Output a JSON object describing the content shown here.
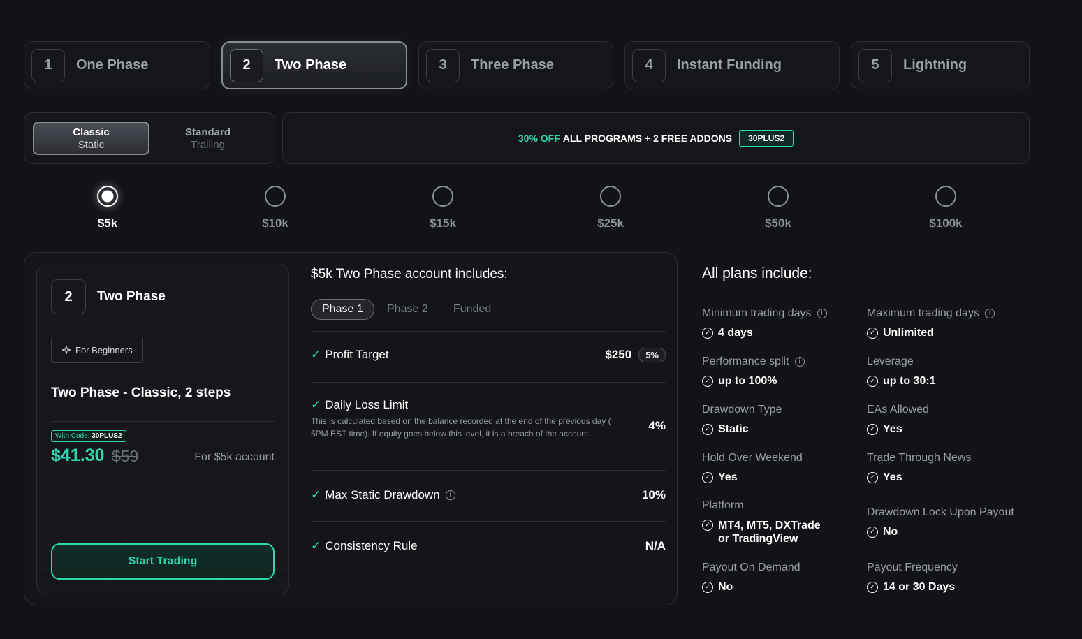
{
  "programs": [
    {
      "num": "1",
      "label": "One Phase"
    },
    {
      "num": "2",
      "label": "Two Phase"
    },
    {
      "num": "3",
      "label": "Three Phase"
    },
    {
      "num": "4",
      "label": "Instant Funding"
    },
    {
      "num": "5",
      "label": "Lightning"
    }
  ],
  "account_types": [
    {
      "title": "Classic",
      "sub": "Static"
    },
    {
      "title": "Standard",
      "sub": "Trailing"
    }
  ],
  "promo": {
    "off": "30% OFF",
    "text": "ALL PROGRAMS + 2 FREE ADDONS",
    "code": "30PLUS2"
  },
  "sizes": [
    "$5k",
    "$10k",
    "$15k",
    "$25k",
    "$50k",
    "$100k"
  ],
  "card": {
    "num": "2",
    "title": "Two Phase",
    "badge": "For Beginners",
    "subtitle": "Two Phase - Classic, 2 steps",
    "with_code_label": "With Code:",
    "with_code_value": "30PLUS2",
    "price": "$41.30",
    "old_price": "$59",
    "for_account": "For $5k account",
    "cta": "Start Trading"
  },
  "includes": {
    "title": "$5k Two Phase account includes:",
    "phases": [
      "Phase 1",
      "Phase 2",
      "Funded"
    ],
    "rules": [
      {
        "label": "Profit Target",
        "value": "$250",
        "pct": "5%"
      },
      {
        "label": "Daily Loss Limit",
        "value": "4%",
        "desc": "This is calculated based on the balance recorded at the end of the previous day ( 5PM EST time). If equity goes below this level, it is a breach of the account."
      },
      {
        "label": "Max Static Drawdown",
        "value": "10%"
      },
      {
        "label": "Consistency Rule",
        "value": "N/A"
      }
    ]
  },
  "all_plans": {
    "title": "All plans include:",
    "left": [
      {
        "label": "Minimum trading days",
        "value": "4 days"
      },
      {
        "label": "Performance split",
        "value": "up to 100%"
      },
      {
        "label": "Drawdown Type",
        "value": "Static"
      },
      {
        "label": "Hold Over Weekend",
        "value": "Yes"
      },
      {
        "label": "Platform",
        "value": "MT4, MT5, DXTrade",
        "value2": "or TradingView"
      },
      {
        "label": "Payout On Demand",
        "value": "No"
      }
    ],
    "right": [
      {
        "label": "Maximum trading days",
        "value": "Unlimited"
      },
      {
        "label": "Leverage",
        "value": "up to 30:1"
      },
      {
        "label": "EAs Allowed",
        "value": "Yes"
      },
      {
        "label": "Trade Through News",
        "value": "Yes"
      },
      {
        "label": "Drawdown Lock Upon Payout",
        "value": "No"
      },
      {
        "label": "Payout Frequency",
        "value": "14 or 30 Days"
      }
    ]
  },
  "colors": {
    "accent": "#2fd6b0",
    "background": "#111317"
  }
}
